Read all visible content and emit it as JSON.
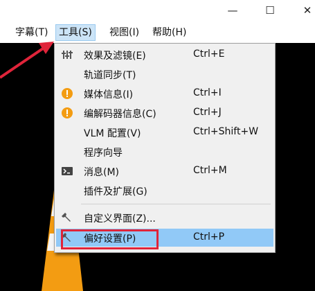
{
  "window": {
    "minimize": "—",
    "maximize": "☐",
    "close": "✕"
  },
  "menubar": {
    "items": [
      {
        "label": "字幕(T)"
      },
      {
        "label": "工具(S)"
      },
      {
        "label": "视图(I)"
      },
      {
        "label": "帮助(H)"
      }
    ]
  },
  "tools_menu": {
    "items": [
      {
        "label": "效果及滤镜(E)",
        "shortcut": "Ctrl+E",
        "icon": "equalizer-icon"
      },
      {
        "label": "轨道同步(T)",
        "shortcut": "",
        "icon": ""
      },
      {
        "label": "媒体信息(I)",
        "shortcut": "Ctrl+I",
        "icon": "info-icon"
      },
      {
        "label": "编解码器信息(C)",
        "shortcut": "Ctrl+J",
        "icon": "info-icon"
      },
      {
        "label": "VLM 配置(V)",
        "shortcut": "Ctrl+Shift+W",
        "icon": ""
      },
      {
        "label": "程序向导",
        "shortcut": "",
        "icon": ""
      },
      {
        "label": "消息(M)",
        "shortcut": "Ctrl+M",
        "icon": "terminal-icon"
      },
      {
        "label": "插件及扩展(G)",
        "shortcut": "",
        "icon": ""
      },
      {
        "label": "自定义界面(Z)...",
        "shortcut": "",
        "icon": "wrench-icon"
      },
      {
        "label": "偏好设置(P)",
        "shortcut": "Ctrl+P",
        "icon": "wrench-icon",
        "highlighted": true
      }
    ]
  },
  "colors": {
    "highlight": "#91c9f7",
    "annotation_red": "#e0243a",
    "info_orange": "#f39c12"
  }
}
